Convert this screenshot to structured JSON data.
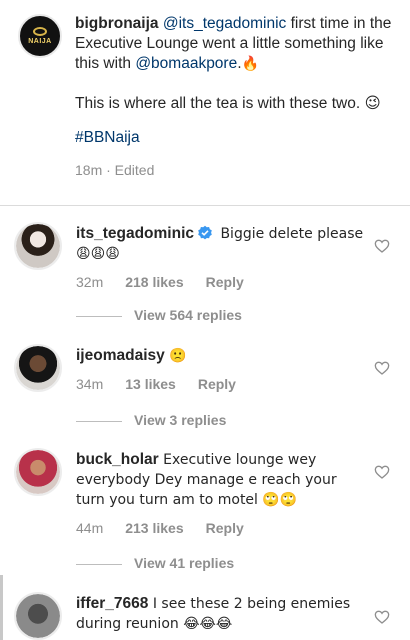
{
  "caption": {
    "username": "bigbronaija",
    "mention1": "@its_tegadominic",
    "text1": " first time in the Executive Lounge went a little something like this with ",
    "mention2": "@bomaakpore",
    "text1_end": ".🔥",
    "text2": "This is where all the tea is with these two. 😉",
    "hashtag": "#BBNaija",
    "meta": "18m · Edited",
    "logo_text": "NAIJA"
  },
  "comments": [
    {
      "username": "its_tegadominic",
      "text": " Biggie delete please 😩😩😩",
      "time": "32m",
      "likes": "218 likes",
      "reply": "Reply",
      "view_replies": "View 564 replies",
      "verified": true
    },
    {
      "username": "ijeomadaisy",
      "text": " 🙁",
      "time": "34m",
      "likes": "13 likes",
      "reply": "Reply",
      "view_replies": "View 3 replies"
    },
    {
      "username": "buck_holar",
      "text": " Executive lounge wey everybody Dey manage e reach your turn you turn am to motel 🙄🙄",
      "time": "44m",
      "likes": "213 likes",
      "reply": "Reply",
      "view_replies": "View 41 replies"
    },
    {
      "username": "iffer_7668",
      "text": " I see these 2 being enemies during reunion 😂😂😂"
    }
  ],
  "colors": {
    "link": "#00376b",
    "meta_gray": "#8e8e8e",
    "verified_blue": "#3897f0"
  },
  "icons": [
    "heart-outline-icon",
    "verified-badge-icon"
  ]
}
